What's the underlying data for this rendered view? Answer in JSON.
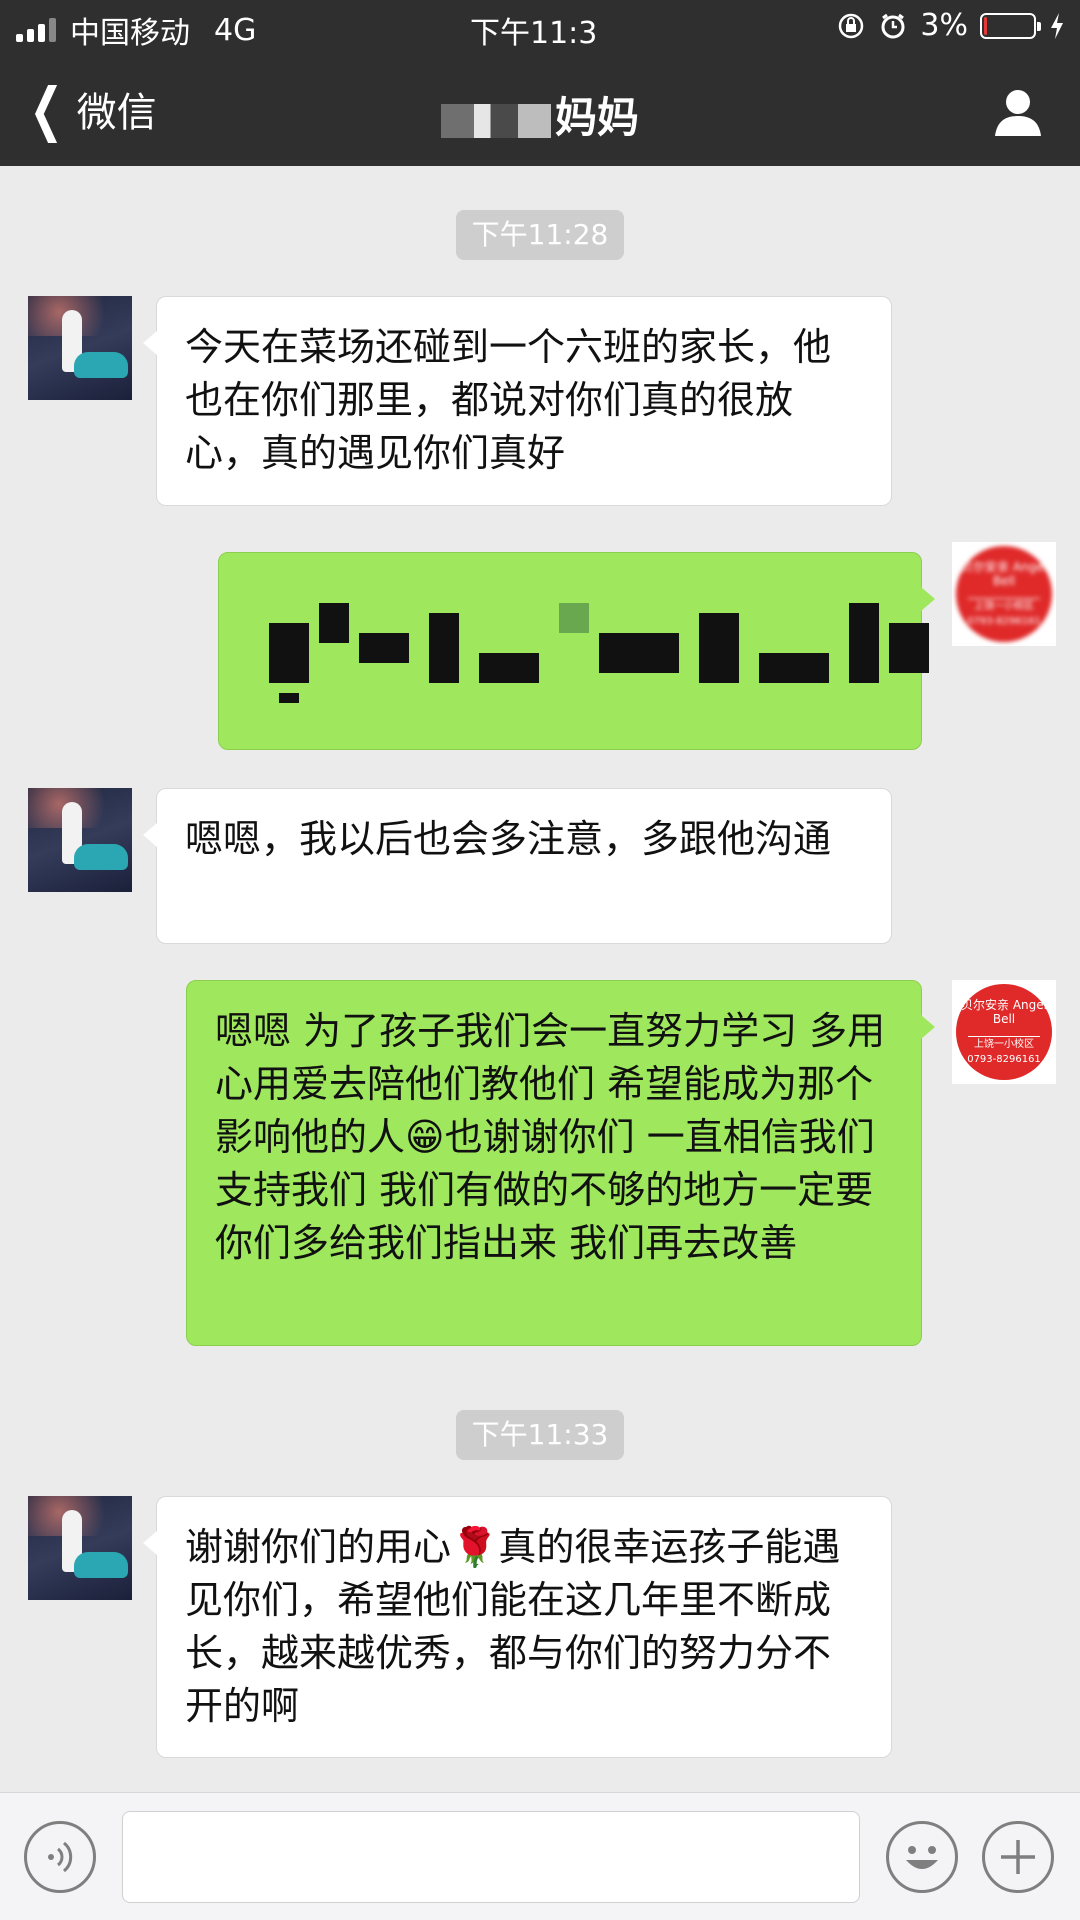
{
  "status_bar": {
    "carrier": "中国移动",
    "network": "4G",
    "time": "下午11:3",
    "battery_percent": "3%",
    "battery_level": 0.03,
    "battery_color": "#e53935",
    "icons": [
      "signal-icon",
      "rotation-lock-icon",
      "alarm-icon",
      "battery-icon",
      "charging-icon"
    ]
  },
  "nav": {
    "back_label": "微信",
    "title": "妈妈",
    "profile_icon": "person-icon"
  },
  "chat": {
    "timestamps": [
      "下午11:28",
      "下午11:33"
    ],
    "messages": [
      {
        "side": "left",
        "text": "今天在菜场还碰到一个六班的家长，他也在你们那里，都说对你们真的很放心，真的遇见你们真好"
      },
      {
        "side": "right",
        "text": "",
        "note_visual": "pixelated"
      },
      {
        "side": "left",
        "text": "嗯嗯，我以后也会多注意，多跟他沟通"
      },
      {
        "side": "right",
        "text": "嗯嗯 为了孩子我们会一直努力学习 多用心用爱去陪他们教他们 希望能成为那个影响他的人😁也谢谢你们 一直相信我们支持我们 我们有做的不够的地方一定要你们多给我们指出来 我们再去改善"
      },
      {
        "side": "left",
        "text": "谢谢你们的用心🌹真的很幸运孩子能遇见你们，希望他们能在这几年里不断成长，越来越优秀，都与你们的努力分不开的啊"
      }
    ],
    "right_avatar": {
      "brand": "贝尔安亲 Angel Bell",
      "line1": "上饶一小校区",
      "line2": "0793-8296161"
    }
  },
  "input_bar": {
    "placeholder": "",
    "voice_icon": "voice-icon",
    "emoji_icon": "emoji-icon",
    "plus_icon": "plus-icon"
  },
  "colors": {
    "header_bg": "#2f2f2f",
    "chat_bg": "#ebebeb",
    "sent_bubble": "#9fe85e",
    "received_bubble": "#ffffff"
  }
}
